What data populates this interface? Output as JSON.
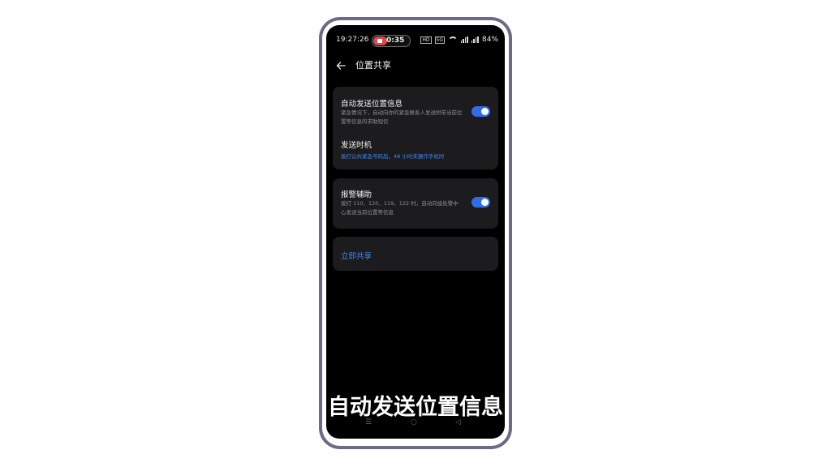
{
  "status_bar": {
    "time": "19:27:26",
    "recording_time": "0:35",
    "battery": "84%",
    "network_badge": "5G",
    "hd_badge": "HD"
  },
  "header": {
    "back_icon": "arrow-left-icon",
    "title": "位置共享"
  },
  "auto_send": {
    "title": "自动发送位置信息",
    "description": "紧急情况下，自动向你的紧急联系人发送附带当前位置等信息的求助短信",
    "enabled": true
  },
  "send_timing": {
    "title": "发送时机",
    "value": "拨打公共紧急号码后，48 小时未操作手机时"
  },
  "alarm_assist": {
    "title": "报警辅助",
    "description": "拨打 110、120、119、122 时，自动向接处警中心发送当前位置等信息",
    "enabled": true
  },
  "share_now": {
    "label": "立即共享"
  },
  "system_nav": {
    "menu_icon": "☰",
    "home_icon": "○",
    "back_icon": "◁"
  },
  "subtitle": {
    "text": "自动发送位置信息"
  },
  "colors": {
    "accent": "#3d87f5",
    "toggle_on": "#2f6ee8",
    "card_bg": "#1c1c1e",
    "frame": "#6c6a86"
  }
}
